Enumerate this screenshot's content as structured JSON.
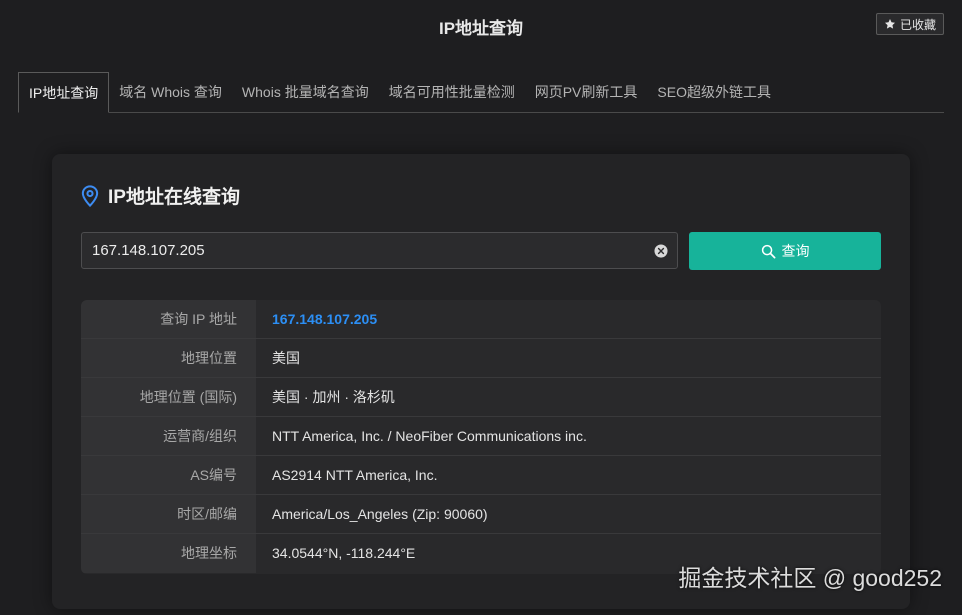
{
  "header": {
    "title": "IP地址查询",
    "favorite_label": "已收藏"
  },
  "tabs": [
    {
      "label": "IP地址查询",
      "active": true
    },
    {
      "label": "域名 Whois 查询",
      "active": false
    },
    {
      "label": "Whois 批量域名查询",
      "active": false
    },
    {
      "label": "域名可用性批量检测",
      "active": false
    },
    {
      "label": "网页PV刷新工具",
      "active": false
    },
    {
      "label": "SEO超级外链工具",
      "active": false
    }
  ],
  "card": {
    "title": "IP地址在线查询",
    "search": {
      "value": "167.148.107.205",
      "button_label": "查询"
    },
    "results": [
      {
        "label": "查询 IP 地址",
        "value": "167.148.107.205"
      },
      {
        "label": "地理位置",
        "value": "美国"
      },
      {
        "label": "地理位置 (国际)",
        "value": "美国 · 加州 · 洛杉矶"
      },
      {
        "label": "运营商/组织",
        "value": "NTT America, Inc. / NeoFiber Communications inc."
      },
      {
        "label": "AS编号",
        "value": "AS2914 NTT America, Inc."
      },
      {
        "label": "时区/邮编",
        "value": "America/Los_Angeles (Zip: 90060)"
      },
      {
        "label": "地理坐标",
        "value": "34.0544°N, -118.244°E"
      }
    ]
  },
  "watermark": "掘金技术社区 @ good252",
  "colors": {
    "accent": "#17b39a",
    "link": "#2c8ff5",
    "background": "#1e1e20"
  }
}
